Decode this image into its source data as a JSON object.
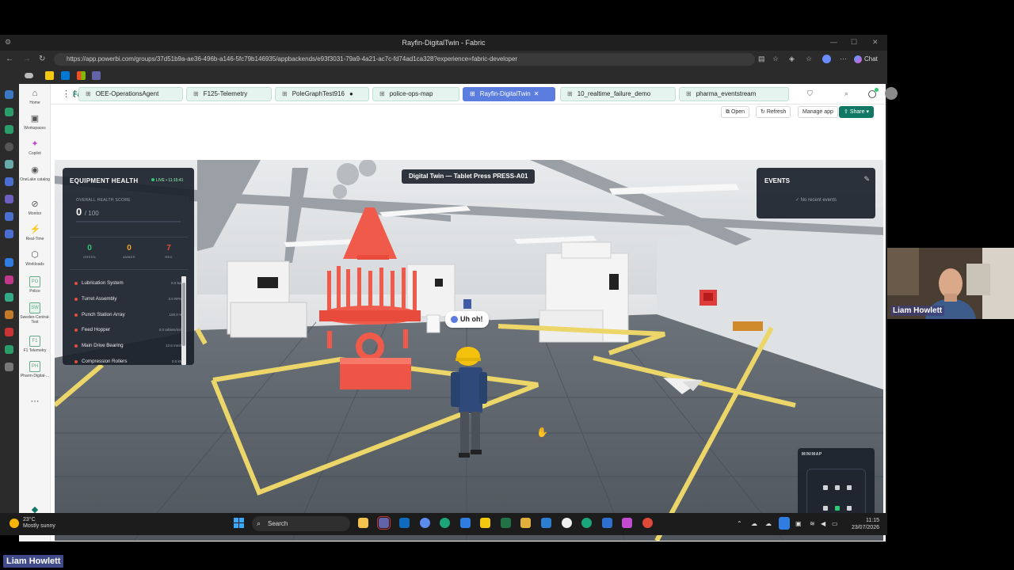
{
  "browser": {
    "title": "Rayfin-DigitalTwin - Fabric",
    "url": "https://app.powerbi.com/groups/37d51b9a-ae36-496b-a146-5fc79b146935/appbackends/e93f3031-79a9-4a21-ac7c-fd74ad1ca328?experience=fabric-developer",
    "chat_label": "Chat"
  },
  "fabric": {
    "brand": "Fabric",
    "rail": [
      {
        "label": "Home",
        "icon": "home-icon"
      },
      {
        "label": "Workspaces",
        "icon": "workspaces-icon"
      },
      {
        "label": "Copilot",
        "icon": "copilot-icon"
      },
      {
        "label": "OneLake catalog",
        "icon": "onelake-icon"
      },
      {
        "label": "Monitor",
        "icon": "monitor-icon"
      },
      {
        "label": "Real-Time",
        "icon": "realtime-icon"
      },
      {
        "label": "Workloads",
        "icon": "workloads-icon"
      },
      {
        "label": "Police",
        "icon": "workspace-item-icon"
      },
      {
        "label": "Sweden-Central-Test",
        "icon": "workspace-item-icon"
      },
      {
        "label": "F1 Telemetry",
        "icon": "workspace-item-icon"
      },
      {
        "label": "Pharm-Digital-...",
        "icon": "workspace-item-icon"
      },
      {
        "label": "...",
        "icon": "more-icon"
      },
      {
        "label": "Fabric",
        "icon": "fabric-logo-icon"
      }
    ],
    "tabs": [
      {
        "label": "OEE-OperationsAgent",
        "active": false
      },
      {
        "label": "F125-Telemetry",
        "active": false
      },
      {
        "label": "PoleGraphTest916",
        "active": false,
        "unsaved": "●"
      },
      {
        "label": "police-ops-map",
        "active": false
      },
      {
        "label": "Rayfin-DigitalTwin",
        "active": true,
        "close": "✕"
      },
      {
        "label": "10_realtime_failure_demo",
        "active": false
      },
      {
        "label": "pharma_eventstream",
        "active": false
      }
    ],
    "actions": {
      "open": "Open",
      "refresh": "Refresh",
      "manage": "Manage app",
      "share": "Share"
    }
  },
  "twin": {
    "title": "Digital Twin — Tablet Press PRESS-A01",
    "speech": "Uh oh!",
    "health": {
      "title": "EQUIPMENT HEALTH",
      "live": "LIVE • 11:15:41",
      "overall_label": "OVERALL HEALTH SCORE",
      "score": "0",
      "score_den": "/ 100",
      "score_fraction": 0,
      "green": {
        "count": "0",
        "label": "GREEN",
        "color": "#2ecc71"
      },
      "amber": {
        "count": "0",
        "label": "AMBER",
        "color": "#f5a623"
      },
      "red": {
        "count": "7",
        "label": "RED",
        "color": "#e74c3c"
      },
      "items": [
        {
          "name": "Lubrication System",
          "value": "0.0 bar"
        },
        {
          "name": "Turret Assembly",
          "value": "3.0 RPM"
        },
        {
          "name": "Punch Station Array",
          "value": "100.0 %"
        },
        {
          "name": "Feed Hopper",
          "value": "0.0 tablets/min"
        },
        {
          "name": "Main Drive Bearing",
          "value": "12.5 mm/s"
        },
        {
          "name": "Compression Rollers",
          "value": "0.0 kN"
        }
      ]
    },
    "events": {
      "title": "EVENTS",
      "empty": "✓ No recent events"
    },
    "minimap": {
      "title": "MINIMAP"
    }
  },
  "taskbar": {
    "temp": "23°C",
    "weather": "Mostly sunny",
    "search": "Search",
    "time": "11:15",
    "date": "23/07/2026"
  },
  "call": {
    "participant": "Liam Howlett",
    "badge": "Liam Howlett"
  },
  "colors": {
    "accent": "#117865",
    "active_tab": "#5b7ddf",
    "alert_red": "#e74c3c",
    "floor": "#5c636b",
    "tape": "#f0d860"
  }
}
